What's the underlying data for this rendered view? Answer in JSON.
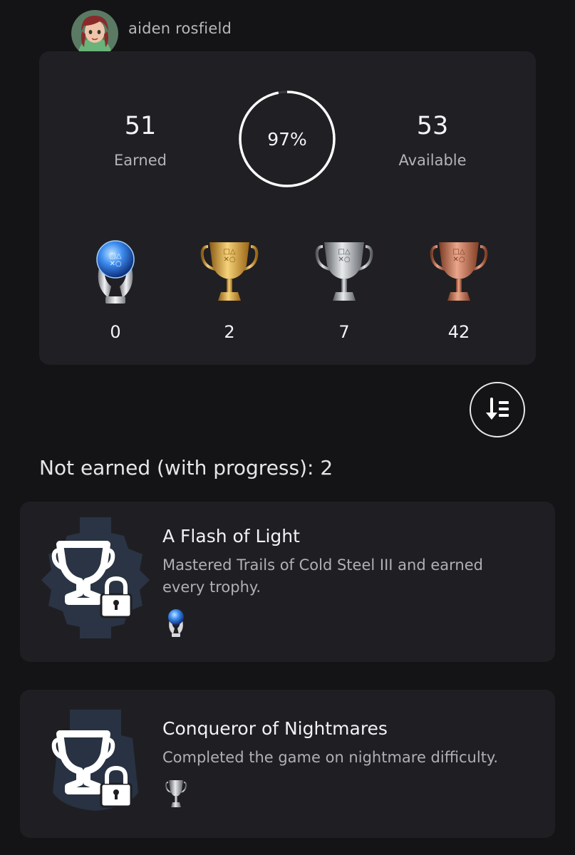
{
  "profile": {
    "username": "aiden rosfield"
  },
  "summary": {
    "earned_count": "51",
    "earned_label": "Earned",
    "progress_text": "97%",
    "progress_fraction": 0.97,
    "available_count": "53",
    "available_label": "Available"
  },
  "trophy_counts": {
    "platinum": "0",
    "gold": "2",
    "silver": "7",
    "bronze": "42"
  },
  "section": {
    "title": "Not earned (with progress): 2"
  },
  "trophies": [
    {
      "name": "A Flash of Light",
      "description": "Mastered Trails of Cold Steel III and earned every trophy.",
      "grade": "platinum-trophy-icon"
    },
    {
      "name": "Conqueror of Nightmares",
      "description": "Completed the game on nightmare difficulty.",
      "grade": "silver-trophy-icon"
    }
  ],
  "colors": {
    "background": "#141416",
    "card": "#202024",
    "gold": "#d9a43a",
    "silver": "#c2c4c8",
    "bronze": "#c27a5a",
    "platinum": "#5aa8ff"
  }
}
